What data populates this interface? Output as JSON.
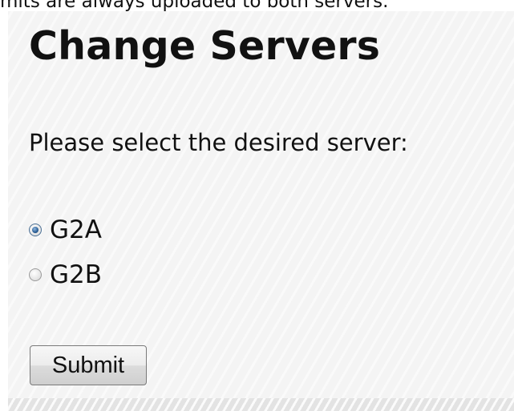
{
  "header": {
    "truncated_text": "mits are always uploaded to both servers."
  },
  "form": {
    "title": "Change Servers",
    "prompt": "Please select the desired server:",
    "options": [
      {
        "label": "G2A",
        "selected": true
      },
      {
        "label": "G2B",
        "selected": false
      }
    ],
    "submit_label": "Submit"
  },
  "colors": {
    "panel_background": "#f4f4f4",
    "radio_selected": "#2a5d93"
  }
}
